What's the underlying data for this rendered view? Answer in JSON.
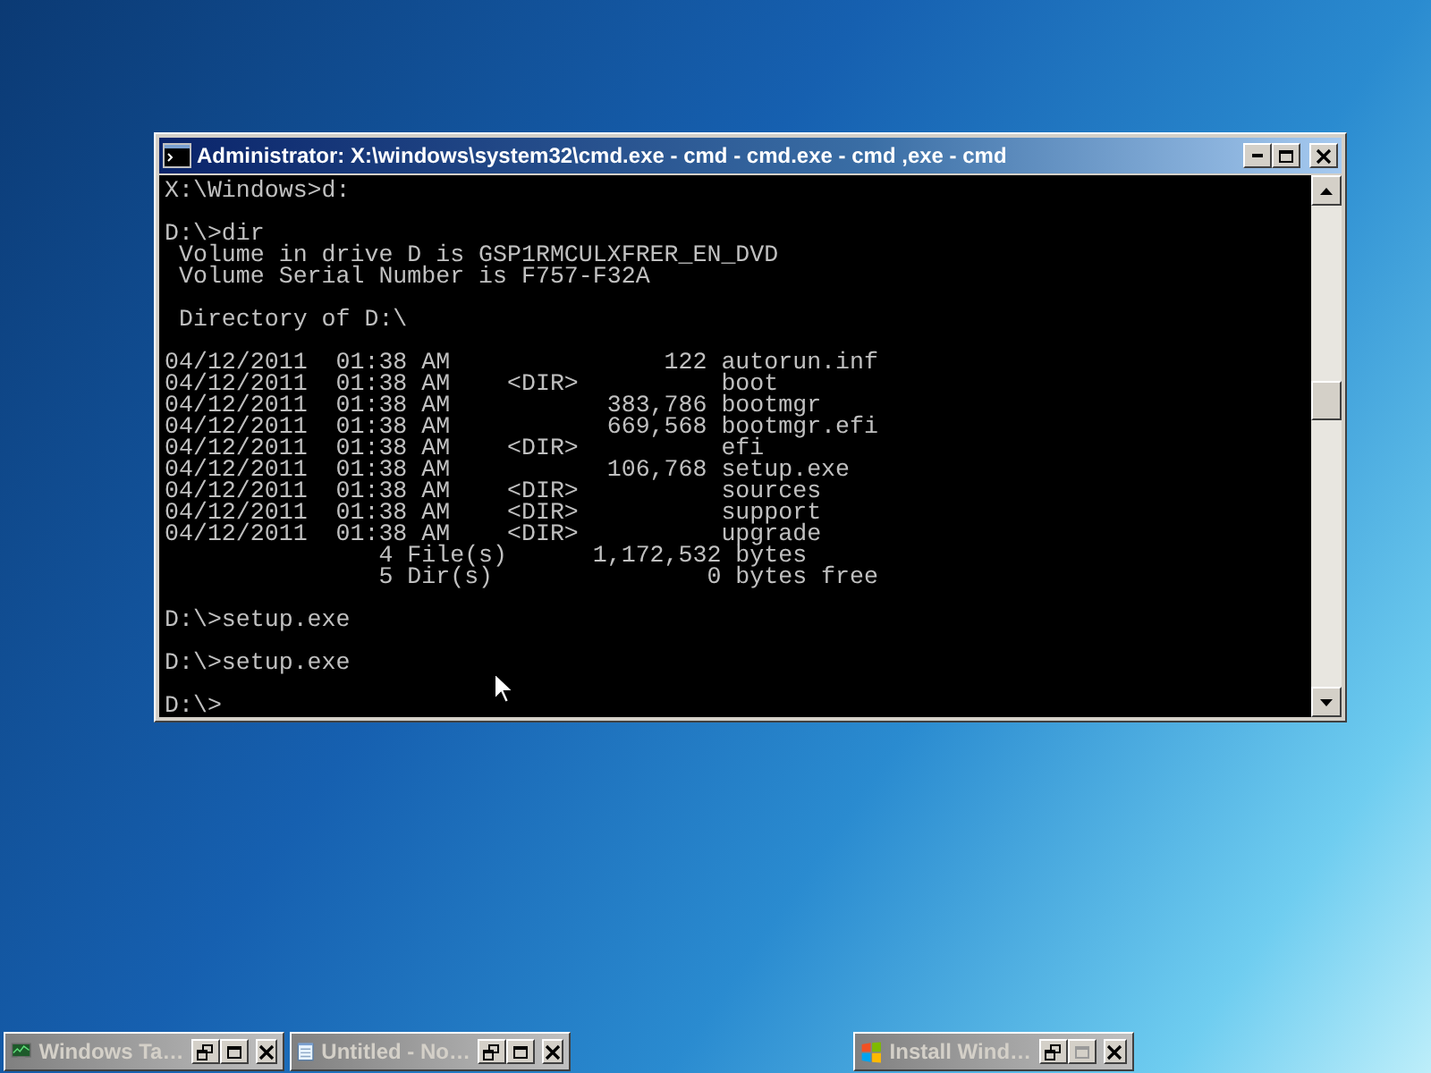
{
  "console_window": {
    "title": "Administrator: X:\\windows\\system32\\cmd.exe - cmd - cmd.exe - cmd ,exe - cmd",
    "blocks": [
      [
        "X:\\Windows>d:"
      ],
      [
        "D:\\>dir",
        " Volume in drive D is GSP1RMCULXFRER_EN_DVD",
        " Volume Serial Number is F757-F32A"
      ],
      [
        " Directory of D:\\"
      ],
      [
        "04/12/2011  01:38 AM               122 autorun.inf",
        "04/12/2011  01:38 AM    <DIR>          boot",
        "04/12/2011  01:38 AM           383,786 bootmgr",
        "04/12/2011  01:38 AM           669,568 bootmgr.efi",
        "04/12/2011  01:38 AM    <DIR>          efi",
        "04/12/2011  01:38 AM           106,768 setup.exe",
        "04/12/2011  01:38 AM    <DIR>          sources",
        "04/12/2011  01:38 AM    <DIR>          support",
        "04/12/2011  01:38 AM    <DIR>          upgrade",
        "               4 File(s)      1,172,532 bytes",
        "               5 Dir(s)               0 bytes free"
      ],
      [
        "D:\\>setup.exe"
      ],
      [
        "D:\\>setup.exe"
      ],
      [
        "D:\\>"
      ]
    ]
  },
  "minimized_windows": [
    {
      "kind": "task-manager",
      "title": "Windows Ta…",
      "maximize_enabled": true
    },
    {
      "kind": "notepad",
      "title": "Untitled - No…",
      "maximize_enabled": true
    },
    {
      "kind": "installer",
      "title": "Install Wind…",
      "maximize_enabled": false
    }
  ]
}
